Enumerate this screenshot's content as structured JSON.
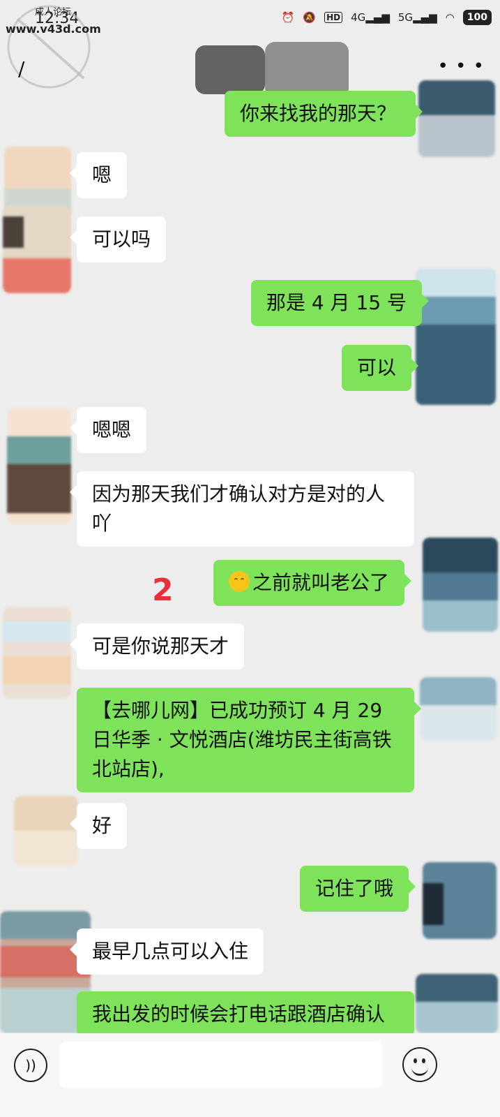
{
  "status_bar": {
    "time": "12:34",
    "network_1": "4G",
    "network_2": "5G",
    "battery": "100",
    "hd_label": "HD"
  },
  "watermark": {
    "line1": "成人论坛",
    "line2": "www.v43d.com"
  },
  "nav": {
    "back_icon": "back-arrow-icon",
    "more_icon": "more-dots-icon",
    "more_label": "• • •"
  },
  "messages": [
    {
      "side": "out",
      "text": "你来找我的那天？"
    },
    {
      "side": "in",
      "text": "嗯"
    },
    {
      "side": "in",
      "text": "可以吗"
    },
    {
      "side": "out",
      "text": "那是 4 月 15 号"
    },
    {
      "side": "out",
      "text": "可以"
    },
    {
      "side": "in",
      "text": "嗯嗯"
    },
    {
      "side": "in",
      "text": "因为那天我们才确认对方是对的人吖"
    },
    {
      "side": "out",
      "text": "之前就叫老公了",
      "emoji": "shy-face-emoji"
    },
    {
      "side": "in",
      "text": "可是你说那天才"
    },
    {
      "side": "out",
      "text": "【去哪儿网】已成功预订 4 月 29 日华季 · 文悦酒店(潍坊民主街高铁北站店),"
    },
    {
      "side": "in",
      "text": "好"
    },
    {
      "side": "out",
      "text": "记住了哦"
    },
    {
      "side": "in",
      "text": "最早几点可以入住"
    },
    {
      "side": "out",
      "text": "我出发的时候会打电话跟酒店确认"
    }
  ],
  "annotation_marker": "2",
  "bottom_bar": {
    "voice_icon": "voice-icon",
    "input_value": "",
    "emoji_icon": "emoji-icon"
  },
  "colors": {
    "background": "#ededed",
    "incoming_bubble": "#ffffff",
    "outgoing_bubble": "#7ee35a",
    "marker": "#e8303a"
  }
}
